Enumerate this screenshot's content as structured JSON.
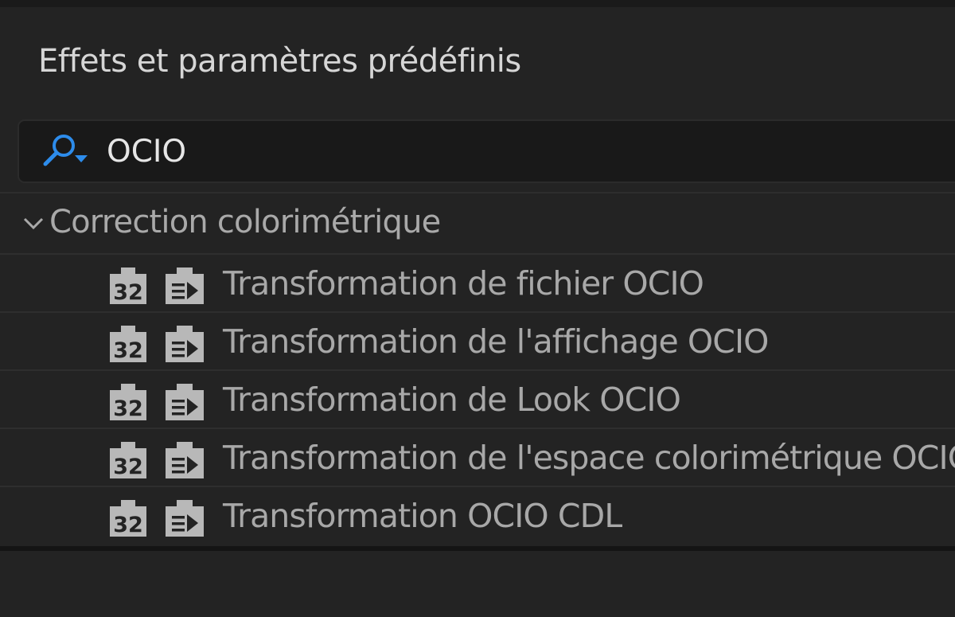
{
  "panel": {
    "title": "Effets et paramètres prédéfinis"
  },
  "search": {
    "value": "OCIO",
    "icon": "search-icon",
    "accent_color": "#2d8ceb"
  },
  "category": {
    "label": "Correction colorimétrique",
    "expanded": true,
    "icon": "chevron-down-icon"
  },
  "effects": [
    {
      "label": "Transformation de fichier OCIO",
      "badges": [
        "32-bit-badge-icon",
        "accelerated-effect-icon"
      ]
    },
    {
      "label": "Transformation de l'affichage OCIO",
      "badges": [
        "32-bit-badge-icon",
        "accelerated-effect-icon"
      ]
    },
    {
      "label": "Transformation de Look OCIO",
      "badges": [
        "32-bit-badge-icon",
        "accelerated-effect-icon"
      ]
    },
    {
      "label": "Transformation de l'espace colorimétrique OCIO",
      "badges": [
        "32-bit-badge-icon",
        "accelerated-effect-icon"
      ]
    },
    {
      "label": "Transformation OCIO CDL",
      "badges": [
        "32-bit-badge-icon",
        "accelerated-effect-icon"
      ]
    }
  ],
  "badge_text": "32"
}
